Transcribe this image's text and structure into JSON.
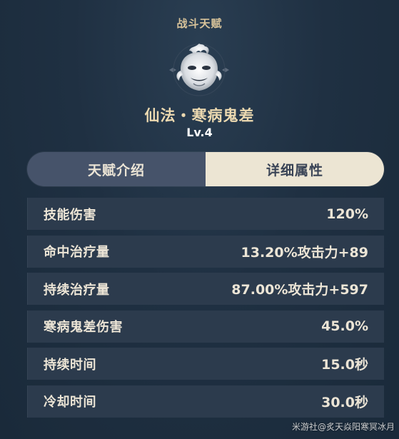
{
  "header": {
    "title": "战斗天赋"
  },
  "talent": {
    "icon": "ghost-mask-icon",
    "name": "仙法・寒病鬼差",
    "level": "Lv.4"
  },
  "tabs": [
    {
      "label": "天赋介绍",
      "active": false
    },
    {
      "label": "详细属性",
      "active": true
    }
  ],
  "attributes": [
    {
      "label": "技能伤害",
      "value": "120%"
    },
    {
      "label": "命中治疗量",
      "value": "13.20%攻击力+89"
    },
    {
      "label": "持续治疗量",
      "value": "87.00%攻击力+597"
    },
    {
      "label": "寒病鬼差伤害",
      "value": "45.0%"
    },
    {
      "label": "持续时间",
      "value": "15.0秒"
    },
    {
      "label": "冷却时间",
      "value": "30.0秒"
    }
  ],
  "watermark": "米游社@炙天焱阳寒冥冰月",
  "colors": {
    "background": "#1f3042",
    "title_gold": "#d8c39a",
    "tab_active": "#ece5d3",
    "tab_inactive": "#46536a",
    "row_bg": "#2c3b4d"
  }
}
